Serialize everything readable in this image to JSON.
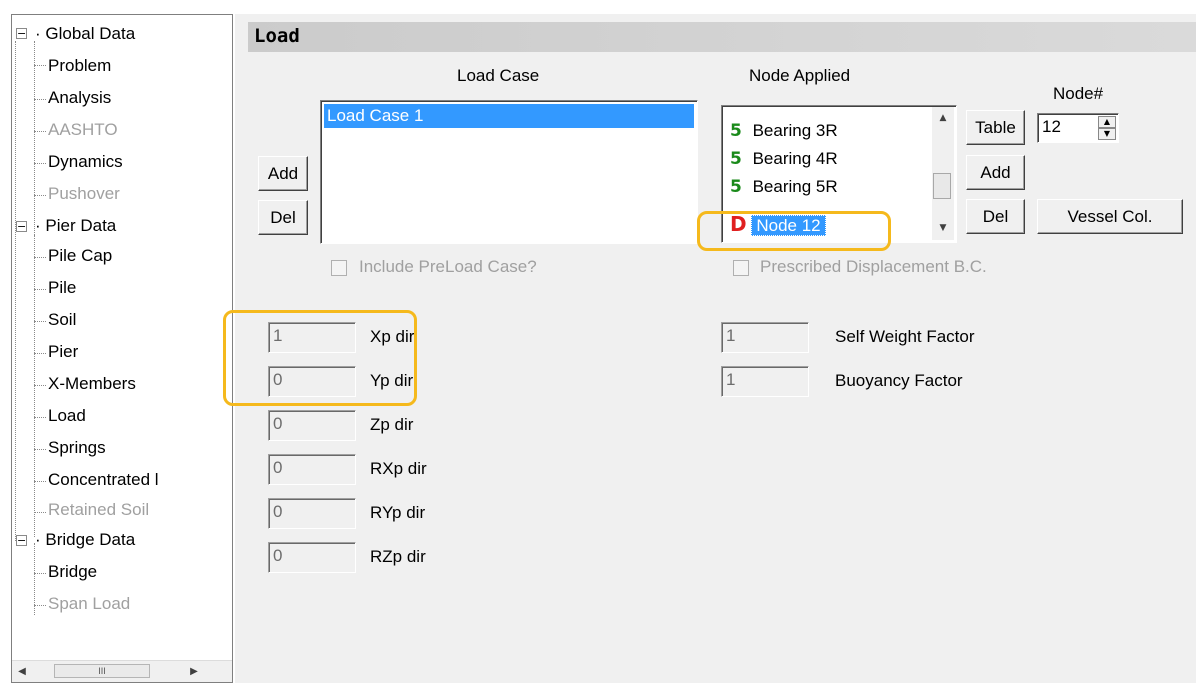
{
  "tree": {
    "global_data": "Global Data",
    "problem": "Problem",
    "analysis": "Analysis",
    "aashto": "AASHTO",
    "dynamics": "Dynamics",
    "pushover": "Pushover",
    "pier_data": "Pier Data",
    "pile_cap": "Pile Cap",
    "pile": "Pile",
    "soil": "Soil",
    "pier": "Pier",
    "x_members": "X-Members",
    "load": "Load",
    "springs": "Springs",
    "concentrated": "Concentrated l",
    "retained_soil": "Retained Soil",
    "bridge_data": "Bridge Data",
    "bridge": "Bridge",
    "span_load": "Span Load",
    "collapse_glyph": "−",
    "scroll_thumb": "III"
  },
  "panel": {
    "title": "Load",
    "load_case_header": "Load Case",
    "node_applied_header": "Node Applied",
    "node_num_label": "Node#",
    "node_num_value": "12",
    "add_label": "Add",
    "del_label": "Del",
    "table_label": "Table",
    "node_add_label": "Add",
    "node_del_label": "Del",
    "vessel_col_label": "Vessel Col.",
    "load_cases": [
      "Load Case 1"
    ],
    "nodes": [
      {
        "type": "S",
        "label": "Bearing 3R"
      },
      {
        "type": "S",
        "label": "Bearing 4R"
      },
      {
        "type": "S",
        "label": "Bearing 5R"
      },
      {
        "type": "D",
        "label": "Node 12"
      }
    ],
    "include_preload": "Include PreLoad Case?",
    "prescribed_disp": "Prescribed Displacement B.C.",
    "xp_value": "1",
    "xp_label": "Xp dir",
    "yp_value": "0",
    "yp_label": "Yp dir",
    "zp_value": "0",
    "zp_label": "Zp dir",
    "rxp_value": "0",
    "rxp_label": "RXp dir",
    "ryp_value": "0",
    "ryp_label": "RYp dir",
    "rzp_value": "0",
    "rzp_label": "RZp dir",
    "self_weight_value": "1",
    "self_weight_label": "Self Weight Factor",
    "buoyancy_value": "1",
    "buoyancy_label": "Buoyancy Factor"
  },
  "colors": {
    "selection": "#3399ff",
    "highlight": "#f5b91c",
    "s_icon": "#1a8a1a",
    "d_icon": "#e02020"
  }
}
